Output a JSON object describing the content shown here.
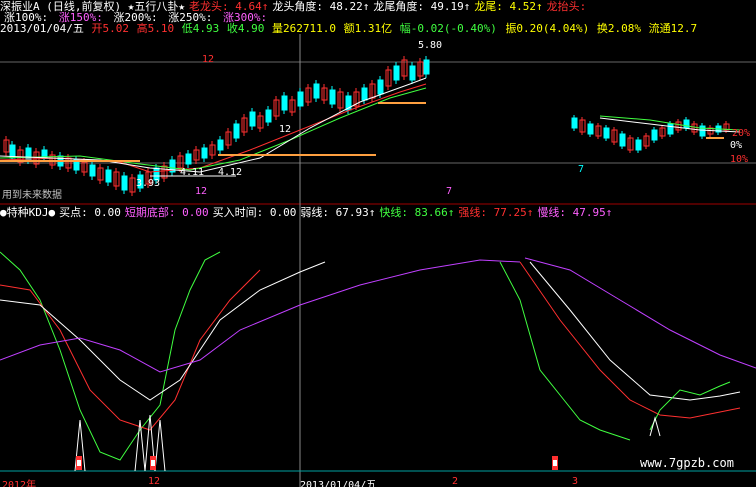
{
  "header": {
    "title": "深振业A (日线,前复权) ★五行八卦★",
    "items1": [
      {
        "label": "老龙头:",
        "value": "4.64↑",
        "color": "#ff3030"
      },
      {
        "label": "龙头角度:",
        "value": "48.22↑",
        "color": "#ffffff"
      },
      {
        "label": "龙尾角度:",
        "value": "49.19↑",
        "color": "#ffffff"
      },
      {
        "label": "龙尾:",
        "value": "4.52↑",
        "color": "#ffff00"
      },
      {
        "label": "龙抬头:",
        "value": "",
        "color": "#ff3030"
      }
    ],
    "items2": [
      {
        "label": "涨100%:",
        "value": "",
        "color": "#ffffff"
      },
      {
        "label": "涨150%:",
        "value": "",
        "color": "#ff60ff"
      },
      {
        "label": "涨200%:",
        "value": "",
        "color": "#ffffff"
      },
      {
        "label": "涨250%:",
        "value": "",
        "color": "#ffffff"
      },
      {
        "label": "涨300%:",
        "value": "",
        "color": "#ff60ff"
      }
    ],
    "quote": {
      "date": "2013/01/04/五",
      "open": "开5.02",
      "high": "高5.10",
      "low": "低4.93",
      "close": "收4.90",
      "vol": "量262711.0",
      "amt": "额1.31亿",
      "chg": "幅-0.02(-0.40%)",
      "amp": "振0.20(4.04%)",
      "turn": "换2.08%",
      "flow": "流通12.7"
    }
  },
  "price_labels": {
    "high": "5.80",
    "mark_12_top": "12",
    "mark_12_mid": "12",
    "mark_12_bottom": "12",
    "low_a": "3.93",
    "low_b": "4.11",
    "low_c": "4.12",
    "mark_7": "7",
    "mark_7_right": "7",
    "future_text": "用到未来数据",
    "right_a": "20%",
    "right_b": "0%",
    "right_c": "10%"
  },
  "indicator_header": {
    "name": "●特种KDJ●",
    "items": [
      {
        "label": "买点:",
        "value": "0.00",
        "color": "#ffffff"
      },
      {
        "label": "短期底部:",
        "value": "0.00",
        "color": "#ff60ff"
      },
      {
        "label": "买入时间:",
        "value": "0.00",
        "color": "#ffffff"
      },
      {
        "label": "弱线:",
        "value": "67.93↑",
        "color": "#ffffff"
      },
      {
        "label": "快线:",
        "value": "83.66↑",
        "color": "#40ff40"
      },
      {
        "label": "强线:",
        "value": "77.25↑",
        "color": "#ff3030"
      },
      {
        "label": "慢线:",
        "value": "47.95↑",
        "color": "#ff60ff"
      }
    ]
  },
  "axis": {
    "left": "2012年",
    "mid1": "12",
    "date": "2013/01/04/五",
    "mid2": "2",
    "right": "3"
  },
  "watermark": "www.7gpzb.com",
  "colors": {
    "up": "#ff3030",
    "down": "#00ffff",
    "ma_red": "#ff3030",
    "ma_green": "#40ff40",
    "ma_white": "#ffffff",
    "orange": "#ffa040",
    "purple": "#c040ff"
  }
}
